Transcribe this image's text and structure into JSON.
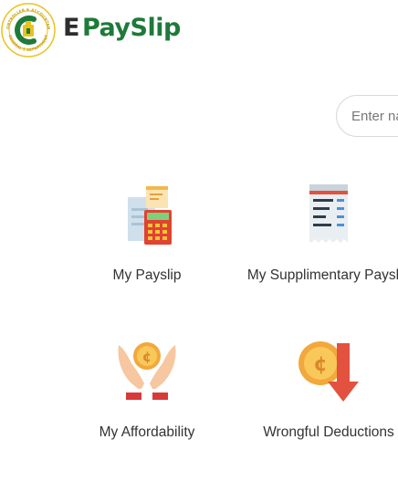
{
  "header": {
    "brand_prefix": "E",
    "brand_name": "PaySlip",
    "seal_text_top": "CONTROLLER & ACCOUNTANT",
    "seal_text_bottom": "GENERAL'S DEPARTMENT"
  },
  "search": {
    "placeholder": "Enter name"
  },
  "tiles": [
    {
      "label": "My Payslip",
      "icon": "payslip-calculator-icon"
    },
    {
      "label": "My Supplimentary Payslip",
      "icon": "receipt-icon"
    },
    {
      "label": "My Affordability",
      "icon": "hands-coin-icon"
    },
    {
      "label": "Wrongful Deductions",
      "icon": "coin-down-arrow-icon"
    }
  ],
  "colors": {
    "brand_green": "#1f7a3a",
    "brand_dark": "#2d2d2d",
    "seal_gold": "#e8c21f",
    "text": "#333333"
  }
}
